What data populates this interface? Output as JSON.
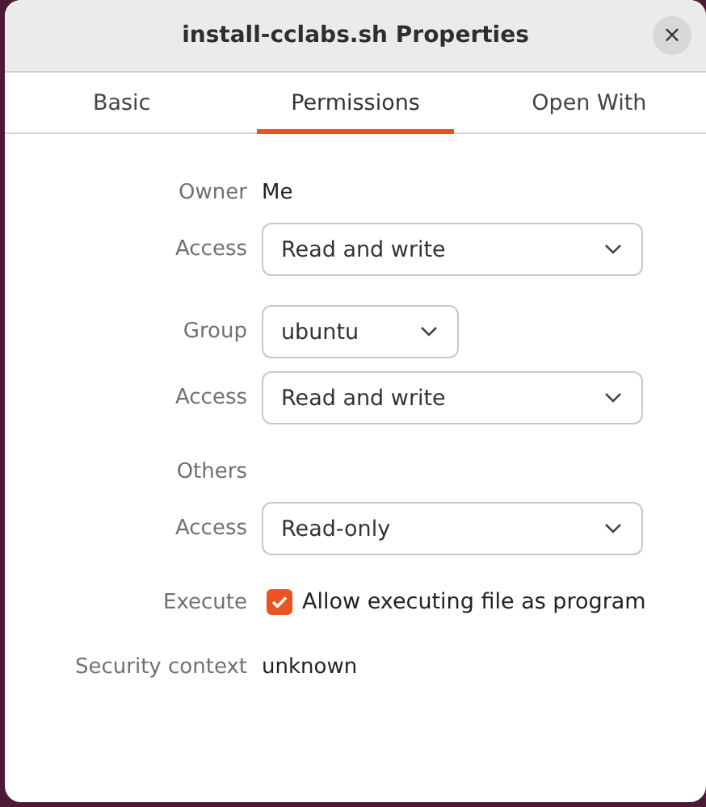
{
  "window": {
    "title": "install-cclabs.sh Properties",
    "close": "×"
  },
  "tabs": [
    {
      "label": "Basic",
      "selected": false
    },
    {
      "label": "Permissions",
      "selected": true
    },
    {
      "label": "Open With",
      "selected": false
    }
  ],
  "sections": [
    {
      "rows": [
        {
          "kind": "text",
          "label": "Owner",
          "value": "Me"
        },
        {
          "kind": "select",
          "label": "Access",
          "value": "Read and write"
        }
      ]
    },
    {
      "rows": [
        {
          "kind": "small-select",
          "label": "Group",
          "value": "ubuntu"
        },
        {
          "kind": "select",
          "label": "Access",
          "value": "Read and write"
        }
      ]
    },
    {
      "rows": [
        {
          "kind": "heading",
          "label": "Others"
        },
        {
          "kind": "select",
          "label": "Access",
          "value": "Read-only"
        }
      ]
    },
    {
      "rows": [
        {
          "kind": "checkbox",
          "label": "Execute",
          "value": "Allow executing file as program",
          "checked": true
        }
      ]
    },
    {
      "rows": [
        {
          "kind": "text",
          "label": "Security context",
          "value": "unknown"
        }
      ]
    }
  ]
}
